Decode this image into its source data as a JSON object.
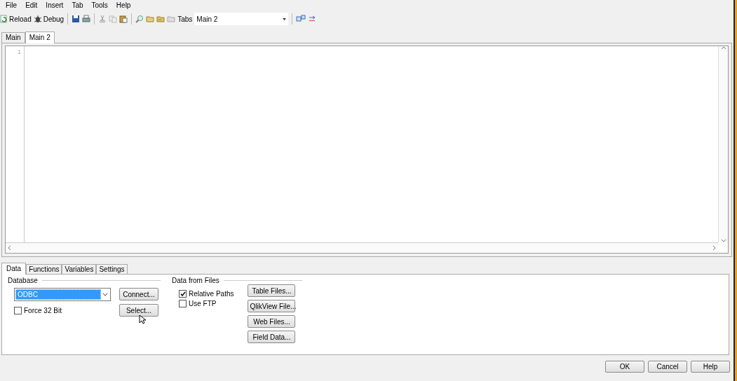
{
  "menu": [
    "File",
    "Edit",
    "Insert",
    "Tab",
    "Tools",
    "Help"
  ],
  "toolbar": {
    "reload": "Reload",
    "debug": "Debug",
    "tabs_label": "Tabs",
    "tabs_value": "Main 2"
  },
  "script_tabs": [
    {
      "label": "Main",
      "selected": false
    },
    {
      "label": "Main 2",
      "selected": true
    }
  ],
  "editor": {
    "line_numbers": [
      "1"
    ]
  },
  "panel_tabs": [
    {
      "label": "Data",
      "selected": true
    },
    {
      "label": "Functions",
      "selected": false
    },
    {
      "label": "Variables",
      "selected": false
    },
    {
      "label": "Settings",
      "selected": false
    }
  ],
  "database": {
    "title": "Database",
    "driver": "ODBC",
    "force32": {
      "label": "Force 32 Bit",
      "checked": false
    },
    "buttons": [
      "Connect...",
      "Select..."
    ]
  },
  "files": {
    "title": "Data from Files",
    "options": [
      {
        "label": "Relative Paths",
        "checked": true
      },
      {
        "label": "Use FTP",
        "checked": false
      }
    ],
    "buttons": [
      "Table Files...",
      "QlikView File...",
      "Web Files...",
      "Field Data..."
    ]
  },
  "dialog_buttons": [
    "OK",
    "Cancel",
    "Help"
  ]
}
